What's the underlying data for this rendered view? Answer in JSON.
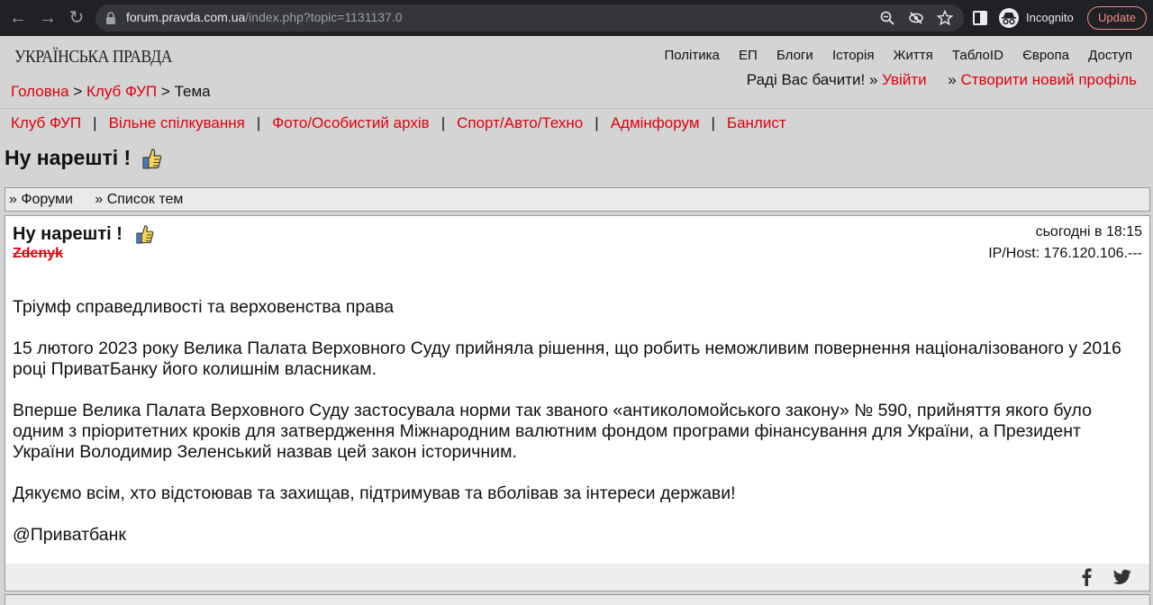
{
  "browser": {
    "url_host": "forum.pravda.com.ua",
    "url_path": "/index.php?topic=1131137.0",
    "incognito_label": "Incognito",
    "update_label": "Update"
  },
  "site": {
    "logo": "УКРАЇНСЬКА ПРАВДА",
    "topnav": [
      "Політика",
      "ЕП",
      "Блоги",
      "Історія",
      "Життя",
      "ТаблоID",
      "Європа",
      "Доступ"
    ],
    "welcome": {
      "text": "Раді Вас бачити! »",
      "login": "Увійти",
      "register_prefix": "»",
      "register": "Створити новий профіль"
    },
    "breadcrumb": {
      "home": "Головна",
      "sep1": ">",
      "club": "Клуб ФУП",
      "sep2": ">",
      "current": "Тема"
    },
    "sections": [
      "Клуб ФУП",
      "Вільне спілкування",
      "Фото/Особистий архів",
      "Спорт/Авто/Техно",
      "Адмінфорум",
      "Банлист"
    ],
    "section_separator": "|"
  },
  "topic": {
    "title": "Ну нарешті !",
    "forumbar": [
      "» Форуми",
      "» Список тем"
    ]
  },
  "post": {
    "title": "Ну нарешті !",
    "author": "Zdenyk",
    "time": "сьогодні в 18:15",
    "ip": "IP/Host: 176.120.106.---",
    "paragraphs": [
      "Тріумф справедливості та верховенства права",
      "15 лютого 2023 року Велика Палата Верховного Суду прийняла рішення, що робить неможливим повернення націоналізованого у 2016 році ПриватБанку його колишнім власникам.",
      "Вперше Велика Палата Верховного Суду застосувала норми так званого «антиколомойського закону» № 590, прийняття якого було одним з пріоритетних кроків для затвердження Міжнародним валютним фондом програми фінансування для України, а Президент України Володимир Зеленський назвав цей закон історичним.",
      "Дякуємо всім, хто відстоював та захищав, підтримував та вболівав за інтереси держави!",
      "@Приватбанк"
    ]
  },
  "colors": {
    "link_red": "#e0000b",
    "page_bg": "#d4d4d4",
    "chrome_bg": "#202124"
  },
  "icons": [
    "back-icon",
    "forward-icon",
    "reload-icon",
    "lock-icon",
    "zoom-icon",
    "eye-off-icon",
    "star-icon",
    "side-panel-icon",
    "incognito-icon",
    "thumbs-up-icon",
    "facebook-icon",
    "twitter-icon"
  ]
}
